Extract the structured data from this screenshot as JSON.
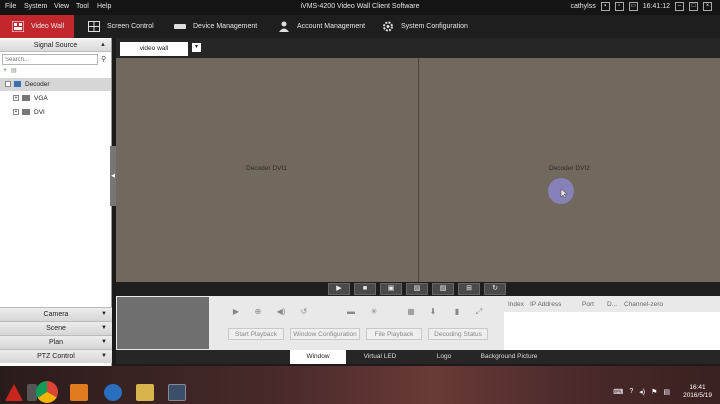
{
  "menubar": {
    "menus": [
      "File",
      "System",
      "View",
      "Tool",
      "Help"
    ],
    "title": "iVMS-4200 Video Wall Client Software",
    "user": "cathylss",
    "time": "16:41:12"
  },
  "nav": {
    "tabs": [
      {
        "label": "Video Wall",
        "icon": "video-wall-icon"
      },
      {
        "label": "Screen Control",
        "icon": "screen-grid-icon"
      },
      {
        "label": "Device Management",
        "icon": "device-icon"
      },
      {
        "label": "Account Management",
        "icon": "person-icon"
      },
      {
        "label": "System Configuration",
        "icon": "gear-icon"
      }
    ]
  },
  "left_panel": {
    "signal_source_label": "Signal Source",
    "search_placeholder": "Search...",
    "tree": [
      {
        "label": "Decoder",
        "level": 0
      },
      {
        "label": "VGA",
        "level": 1
      },
      {
        "label": "DVI",
        "level": 1
      }
    ],
    "bottom_nav": [
      "Camera",
      "Scene",
      "Plan",
      "PTZ Control"
    ]
  },
  "wall": {
    "tab_label": "video wall",
    "add_tab_label": "▾",
    "decoders": [
      "Decoder DVI1",
      "Decoder DVI2"
    ]
  },
  "playback": {
    "buttons": [
      "Start Playback",
      "Window Configuration",
      "File Playback",
      "Decoding Status"
    ],
    "channel_headers": [
      "Index",
      "IP Address",
      "Port",
      "D...",
      "Channel-zero"
    ]
  },
  "bottom_tabs": [
    "Window",
    "Virtual LED",
    "Logo",
    "Background Picture"
  ],
  "taskbar": {
    "time": "16:41",
    "date": "2016/5/19"
  },
  "colors": {
    "accent_red": "#c1272d",
    "wall_bg": "#71685e"
  }
}
